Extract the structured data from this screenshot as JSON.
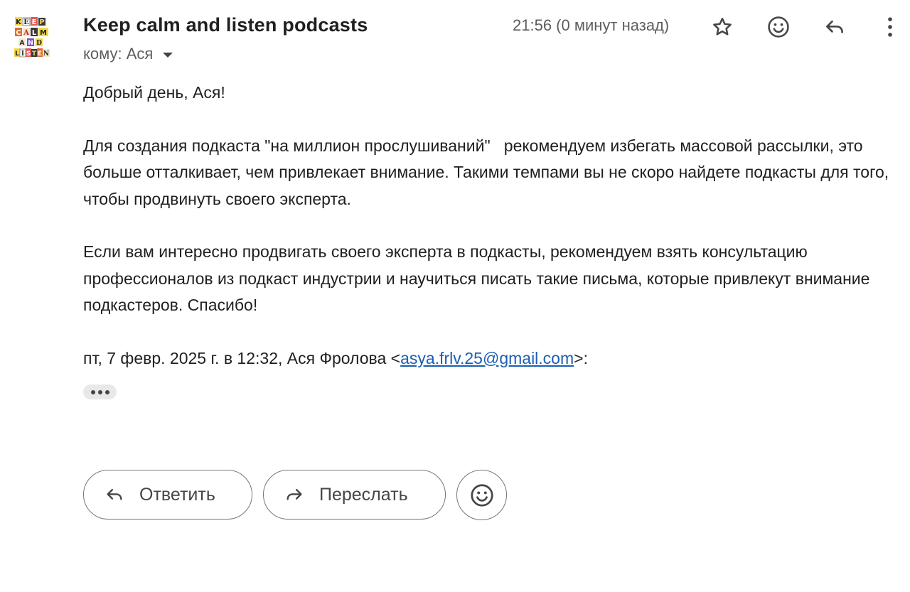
{
  "avatar": {
    "logo_lines": [
      "KEEP",
      "CALM",
      "AND",
      "LISTEN"
    ]
  },
  "header": {
    "sender": "Keep calm and listen podcasts",
    "recipient_label": "кому: Ася",
    "timestamp": "21:56 (0 минут назад)",
    "icons": [
      "star-icon",
      "emoji-icon",
      "reply-icon",
      "more-vert-icon"
    ]
  },
  "message": {
    "greeting": "Добрый день, Ася!",
    "paragraph1": "Для создания подкаста \"на миллион прослушиваний\"   рекомендуем избегать массовой рассылки, это больше отталкивает, чем привлекает внимание. Такими темпами вы не скоро найдете подкасты для того, чтобы продвинуть своего эксперта.",
    "paragraph2": "Если вам интересно продвигать своего эксперта в подкасты, рекомендуем взять консультацию профессионалов из подкаст индустрии и научиться писать такие письма, которые привлекут внимание подкастеров. Спасибо!",
    "quote_prefix": "пт, 7 февр. 2025 г. в 12:32, Ася Фролова <",
    "quote_email": "asya.frlv.25@gmail.com",
    "quote_suffix": ">:"
  },
  "actions": {
    "reply_label": "Ответить",
    "forward_label": "Переслать"
  },
  "colors": {
    "link": "#1a5fb4",
    "text": "#1f1f1f",
    "muted": "#5e5e5e",
    "button_border": "#747775"
  }
}
